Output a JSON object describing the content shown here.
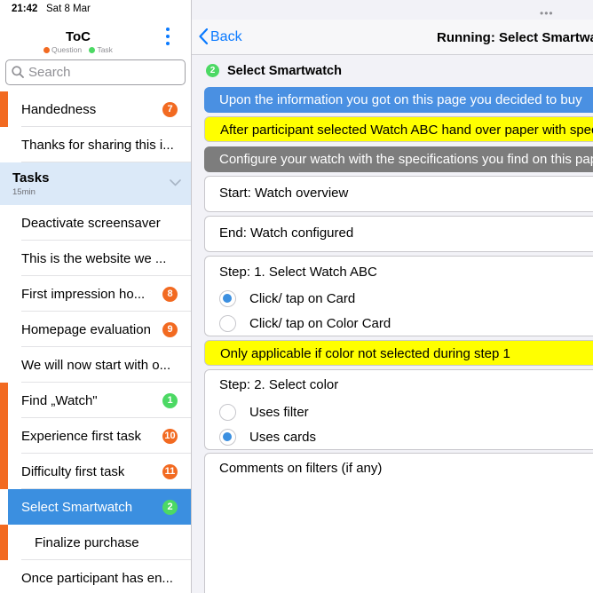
{
  "status": {
    "time": "21:42",
    "date": "Sat 8 Mar"
  },
  "sidebar": {
    "title": "ToC",
    "legend": {
      "question": "Question",
      "task": "Task",
      "question_color": "#f26a21",
      "task_color": "#4cd964"
    },
    "search_placeholder": "Search",
    "items": [
      {
        "label": "Handedness",
        "badge": "7",
        "badge_color": "#f26a21",
        "accent": true
      },
      {
        "label": "Thanks for sharing this i..."
      },
      {
        "section": true,
        "title": "Tasks",
        "subtitle": "15min"
      },
      {
        "label": "Deactivate screensaver"
      },
      {
        "label": "This is the website we ..."
      },
      {
        "label": "First impression ho...",
        "badge": "8",
        "badge_color": "#f26a21"
      },
      {
        "label": "Homepage evaluation",
        "badge": "9",
        "badge_color": "#f26a21"
      },
      {
        "label": "We will now start with o..."
      },
      {
        "label": "Find „Watch\"",
        "badge": "1",
        "badge_color": "#4cd964",
        "accent": true
      },
      {
        "label": "Experience first task",
        "badge": "10",
        "badge_color": "#f26a21",
        "accent": true
      },
      {
        "label": "Difficulty first task",
        "badge": "11",
        "badge_color": "#f26a21",
        "accent": true
      },
      {
        "label": "Select Smartwatch",
        "badge": "2",
        "badge_color": "#4cd964",
        "selected": true
      },
      {
        "label": "Finalize purchase",
        "indent": true,
        "accent": true
      },
      {
        "label": "Once participant has en..."
      }
    ]
  },
  "nav": {
    "back_label": "Back",
    "title": "Running: Select Smartwatch"
  },
  "step": {
    "number": "2",
    "title": "Select Smartwatch"
  },
  "content": {
    "banner_blue": "Upon the information you got on this page you decided to buy",
    "banner_yellow": "After participant selected Watch ABC hand over paper with specifications",
    "banner_gray": "Configure your watch with the specifications you find on this paper",
    "start": "Start: Watch overview",
    "end": "End: Watch configured",
    "step1": {
      "title": "Step: 1. Select Watch ABC",
      "options": [
        {
          "label": "Click/ tap on Card",
          "selected": true
        },
        {
          "label": "Click/ tap on Color Card",
          "selected": false
        }
      ]
    },
    "note_yellow": "Only applicable if color not selected during step 1",
    "step2": {
      "title": "Step: 2. Select color",
      "options": [
        {
          "label": "Uses filter",
          "selected": false
        },
        {
          "label": "Uses cards",
          "selected": true
        }
      ]
    },
    "comments_label": "Comments on filters (if any)"
  }
}
